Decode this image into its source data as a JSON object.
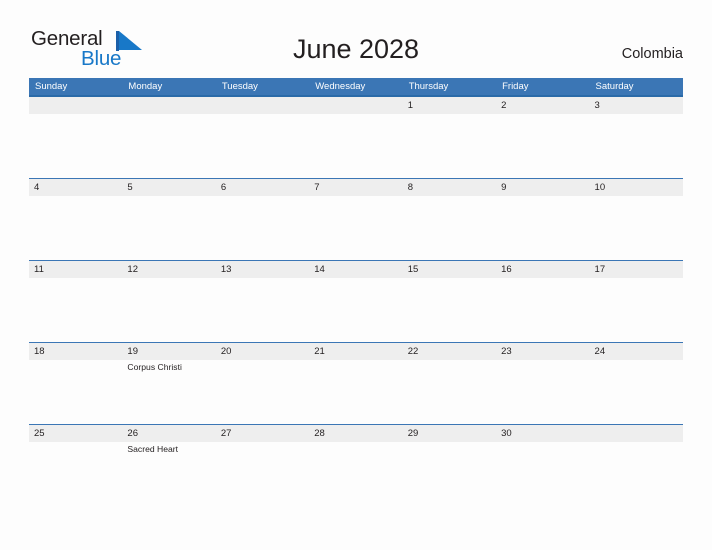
{
  "brand": {
    "name_part1": "General",
    "name_part2": "Blue",
    "mark": "triangle-logo-icon",
    "color_primary": "#1878c8",
    "color_text": "#231f20"
  },
  "header": {
    "title": "June 2028",
    "region": "Colombia"
  },
  "calendar": {
    "header_bg": "#3b76b5",
    "header_rule": "#2a6aa8",
    "date_band_bg": "#eeeeee",
    "row_rule": "#3b76b5",
    "weekdays": [
      "Sunday",
      "Monday",
      "Tuesday",
      "Wednesday",
      "Thursday",
      "Friday",
      "Saturday"
    ],
    "weeks": [
      [
        {
          "day": "",
          "event": ""
        },
        {
          "day": "",
          "event": ""
        },
        {
          "day": "",
          "event": ""
        },
        {
          "day": "",
          "event": ""
        },
        {
          "day": "1",
          "event": ""
        },
        {
          "day": "2",
          "event": ""
        },
        {
          "day": "3",
          "event": ""
        }
      ],
      [
        {
          "day": "4",
          "event": ""
        },
        {
          "day": "5",
          "event": ""
        },
        {
          "day": "6",
          "event": ""
        },
        {
          "day": "7",
          "event": ""
        },
        {
          "day": "8",
          "event": ""
        },
        {
          "day": "9",
          "event": ""
        },
        {
          "day": "10",
          "event": ""
        }
      ],
      [
        {
          "day": "11",
          "event": ""
        },
        {
          "day": "12",
          "event": ""
        },
        {
          "day": "13",
          "event": ""
        },
        {
          "day": "14",
          "event": ""
        },
        {
          "day": "15",
          "event": ""
        },
        {
          "day": "16",
          "event": ""
        },
        {
          "day": "17",
          "event": ""
        }
      ],
      [
        {
          "day": "18",
          "event": ""
        },
        {
          "day": "19",
          "event": "Corpus Christi"
        },
        {
          "day": "20",
          "event": ""
        },
        {
          "day": "21",
          "event": ""
        },
        {
          "day": "22",
          "event": ""
        },
        {
          "day": "23",
          "event": ""
        },
        {
          "day": "24",
          "event": ""
        }
      ],
      [
        {
          "day": "25",
          "event": ""
        },
        {
          "day": "26",
          "event": "Sacred Heart"
        },
        {
          "day": "27",
          "event": ""
        },
        {
          "day": "28",
          "event": ""
        },
        {
          "day": "29",
          "event": ""
        },
        {
          "day": "30",
          "event": ""
        },
        {
          "day": "",
          "event": ""
        }
      ]
    ]
  }
}
